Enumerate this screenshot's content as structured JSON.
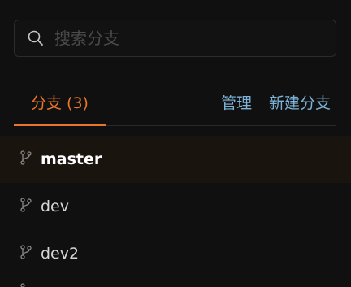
{
  "search": {
    "placeholder": "搜索分支",
    "value": ""
  },
  "tabs": {
    "branches_label": "分支 (3)",
    "manage_label": "管理",
    "new_branch_label": "新建分支"
  },
  "branches": [
    {
      "name": "master",
      "active": true
    },
    {
      "name": "dev",
      "active": false
    },
    {
      "name": "dev2",
      "active": false
    }
  ],
  "colors": {
    "background": "#101010",
    "accent": "#e8752c",
    "link": "#7db3d8",
    "active_row": "#19140e",
    "text": "#d6d6d6"
  },
  "icons": {
    "search": "search-icon",
    "branch": "git-branch-icon"
  }
}
